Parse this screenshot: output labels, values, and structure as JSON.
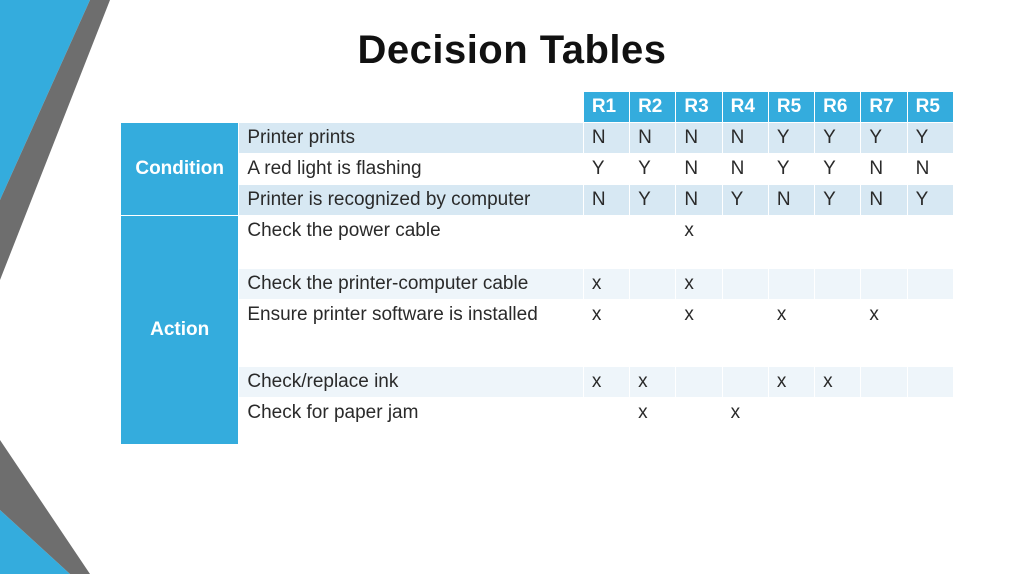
{
  "title": "Decision Tables",
  "rules": [
    "R1",
    "R2",
    "R3",
    "R4",
    "R5",
    "R6",
    "R7",
    "R5"
  ],
  "section_labels": {
    "condition": "Condition",
    "action": "Action"
  },
  "conditions": [
    {
      "label": "Printer prints",
      "cells": [
        "N",
        "N",
        "N",
        "N",
        "Y",
        "Y",
        "Y",
        "Y"
      ]
    },
    {
      "label": "A red light is flashing",
      "cells": [
        "Y",
        "Y",
        "N",
        "N",
        "Y",
        "Y",
        "N",
        "N"
      ]
    },
    {
      "label": "Printer is recognized by computer",
      "cells": [
        "N",
        "Y",
        "N",
        "Y",
        "N",
        "Y",
        "N",
        "Y"
      ]
    }
  ],
  "actions": [
    {
      "label": "Check the power cable",
      "cells": [
        "",
        "",
        "x",
        "",
        "",
        "",
        "",
        ""
      ]
    },
    {
      "label": "Check the printer-computer cable",
      "cells": [
        "x",
        "",
        "x",
        "",
        "",
        "",
        "",
        ""
      ]
    },
    {
      "label": "Ensure printer software is installed",
      "cells": [
        "x",
        "",
        "x",
        "",
        "x",
        "",
        "x",
        ""
      ]
    },
    {
      "label": "Check/replace ink",
      "cells": [
        "x",
        "x",
        "",
        "",
        "x",
        "x",
        "",
        ""
      ]
    },
    {
      "label": "Check for paper jam",
      "cells": [
        "",
        "x",
        "",
        "x",
        "",
        "",
        "",
        ""
      ]
    }
  ]
}
